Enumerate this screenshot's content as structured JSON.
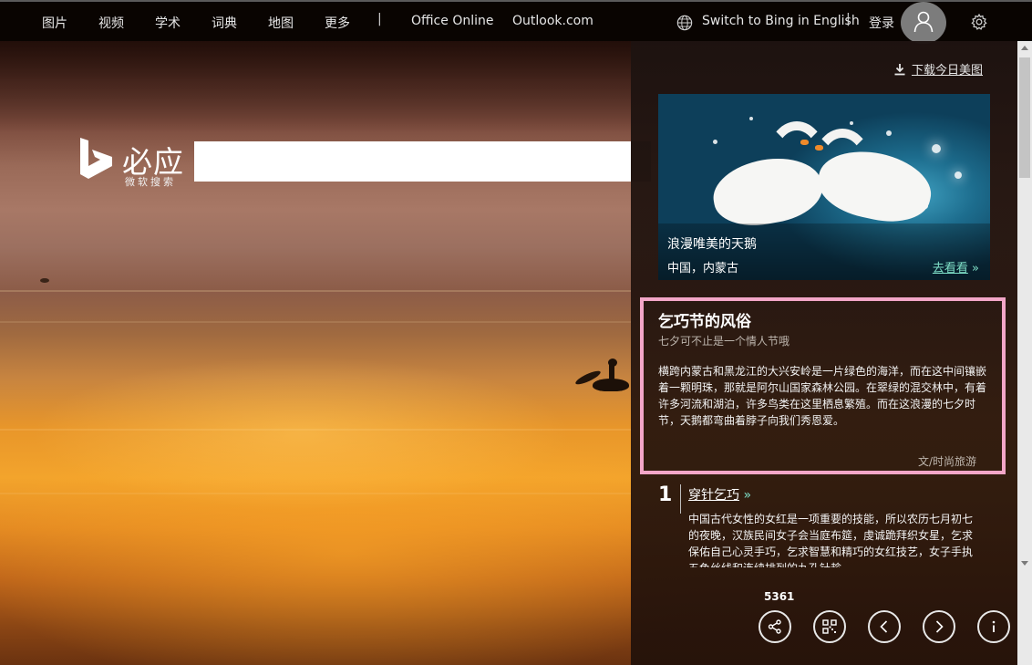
{
  "nav": {
    "items": [
      "图片",
      "视频",
      "学术",
      "词典",
      "地图",
      "更多"
    ],
    "separator": "|",
    "office": "Office Online",
    "outlook": "Outlook.com",
    "switch_lang": "Switch to Bing in English",
    "login": "登录"
  },
  "logo": {
    "name": "必应",
    "subtitle": "微软搜索"
  },
  "search": {
    "value": "",
    "placeholder": ""
  },
  "panel": {
    "download": "下载今日美图",
    "card": {
      "title": "浪漫唯美的天鹅",
      "location": "中国，内蒙古",
      "more": "去看看",
      "more_chevron": "»"
    },
    "story": {
      "title": "乞巧节的风俗",
      "subtitle": "七夕可不止是一个情人节哦",
      "body": "横跨内蒙古和黑龙江的大兴安岭是一片绿色的海洋，而在这中间镶嵌着一颗明珠，那就是阿尔山国家森林公园。在翠绿的混交林中，有着许多河流和湖泊，许多鸟类在这里栖息繁殖。而在这浪漫的七夕时节，天鹅都弯曲着脖子向我们秀恩爱。",
      "credit": "文/时尚旅游"
    },
    "item": {
      "number": "1",
      "title": "穿针乞巧",
      "chevron": "»",
      "body": "中国古代女性的女红是一项重要的技能，所以农历七月初七的夜晚，汉族民间女子会当庭布筵，虔诚跪拜织女星，乞求保佑自己心灵手巧，乞求智慧和精巧的女红技艺，女子手执五色丝线和连续排列的九孔针趁"
    },
    "like_count": "5361",
    "buttons": [
      "share-icon",
      "qr-code-icon",
      "previous-icon",
      "next-icon",
      "info-icon"
    ]
  },
  "colors": {
    "accent": "#7fe0c8",
    "highlight_border": "#f3a6c8",
    "topbar": "#1a1a1a"
  }
}
